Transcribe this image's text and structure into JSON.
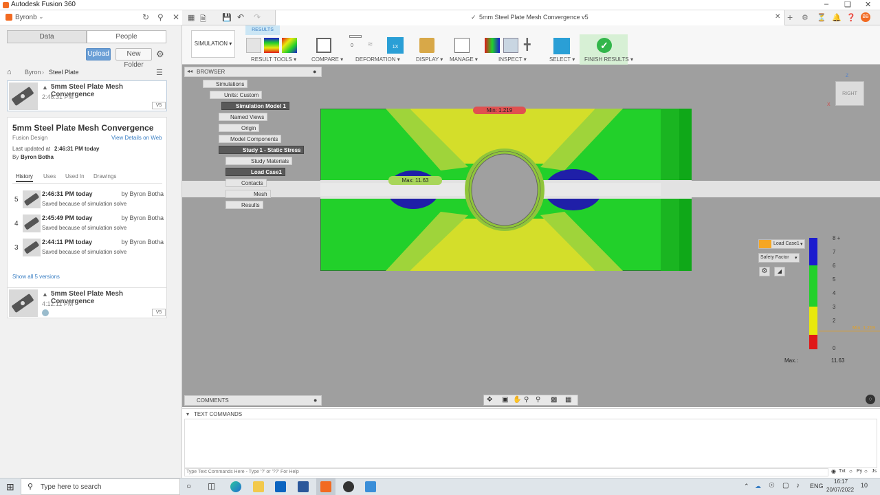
{
  "window": {
    "app_title": "Autodesk Fusion 360"
  },
  "data_panel": {
    "user": "Byronb",
    "tabs": [
      "Data",
      "People"
    ],
    "upload_label": "Upload",
    "new_folder_label": "New Folder",
    "breadcrumb": [
      "Byron",
      "Steel Plate"
    ],
    "top_card": {
      "title": "5mm Steel Plate Mesh Convergence",
      "time": "2:46:31 PM",
      "version": "V5"
    },
    "details": {
      "title": "5mm Steel Plate Mesh Convergence",
      "type": "Fusion Design",
      "view_link": "View Details on Web",
      "updated_prefix": "Last updated at",
      "updated": "2:46:31 PM today",
      "by_prefix": "By",
      "by": "Byron Botha",
      "subtabs": [
        "History",
        "Uses",
        "Used In",
        "Drawings"
      ],
      "history": [
        {
          "num": "5",
          "time": "2:46:31 PM today",
          "by": "by Byron Botha",
          "desc": "Saved because of simulation solve"
        },
        {
          "num": "4",
          "time": "2:45:49 PM today",
          "by": "by Byron Botha",
          "desc": "Saved because of simulation solve"
        },
        {
          "num": "3",
          "time": "2:44:11 PM today",
          "by": "by Byron Botha",
          "desc": "Saved because of simulation solve"
        }
      ],
      "show_all": "Show all 5 versions"
    },
    "bottom_card": {
      "title": "5mm Steel Plate Mesh Convergence",
      "time": "4:12:11 PM",
      "version": "V5"
    }
  },
  "document_tab": {
    "title": "5mm Steel Plate Mesh Convergence v5"
  },
  "ribbon": {
    "workspace": "SIMULATION",
    "active_tab": "RESULTS",
    "groups": [
      {
        "label": "RESULT TOOLS"
      },
      {
        "label": "COMPARE"
      },
      {
        "label": "DEFORMATION"
      },
      {
        "label": "DISPLAY"
      },
      {
        "label": "MANAGE"
      },
      {
        "label": "INSPECT"
      },
      {
        "label": "SELECT"
      },
      {
        "label": "FINISH RESULTS"
      }
    ],
    "deformation_value": "0",
    "deformation_active": "1X"
  },
  "browser": {
    "title": "BROWSER",
    "nodes": [
      {
        "label": "Simulations"
      },
      {
        "label": "Units: Custom"
      },
      {
        "label": "Simulation Model 1"
      },
      {
        "label": "Named Views"
      },
      {
        "label": "Origin"
      },
      {
        "label": "Model Components"
      },
      {
        "label": "Study 1 - Static Stress"
      },
      {
        "label": "Study Materials"
      },
      {
        "label": "Load Case1"
      },
      {
        "label": "Contacts"
      },
      {
        "label": "Mesh"
      },
      {
        "label": "Results"
      }
    ]
  },
  "viewcube": {
    "face": "RIGHT",
    "axis_z": "Z",
    "axis_x": "X"
  },
  "results": {
    "min_label": "Min: 1.219",
    "max_label": "Max: 11.63",
    "legend": {
      "load_case": "Load Case1",
      "result_type": "Safety Factor",
      "ticks": [
        "8 +",
        "7",
        "6",
        "5",
        "4",
        "3",
        "2",
        "0"
      ],
      "min_marker": "Min. 1.219",
      "max_prefix": "Max.:",
      "max_value": "11.63",
      "colors": [
        "#1c1ccf",
        "#22d02a",
        "#e8e80c",
        "#e01818"
      ]
    }
  },
  "comments": {
    "label": "COMMENTS"
  },
  "text_commands": {
    "label": "TEXT COMMANDS",
    "placeholder": "Type Text Commands Here - Type '?' or '??' For Help",
    "modes": [
      "Txt",
      "Py",
      "Js"
    ]
  },
  "taskbar": {
    "search_placeholder": "Type here to search",
    "lang": "ENG",
    "time": "16:17",
    "date": "20/07/2022",
    "notif": "10"
  }
}
